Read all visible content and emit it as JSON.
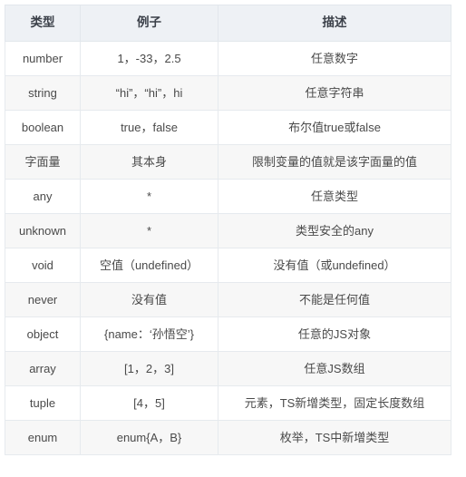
{
  "table": {
    "columns": [
      {
        "key": "type",
        "label": "类型"
      },
      {
        "key": "example",
        "label": "例子"
      },
      {
        "key": "description",
        "label": "描述"
      }
    ],
    "rows": [
      {
        "type": "number",
        "example": "1，-33，2.5",
        "description": "任意数字"
      },
      {
        "type": "string",
        "example": "“hi”，“hi”，hi",
        "description": "任意字符串"
      },
      {
        "type": "boolean",
        "example": "true，false",
        "description": "布尔值true或false"
      },
      {
        "type": "字面量",
        "example": "其本身",
        "description": "限制变量的值就是该字面量的值"
      },
      {
        "type": "any",
        "example": "*",
        "description": "任意类型"
      },
      {
        "type": "unknown",
        "example": "*",
        "description": "类型安全的any"
      },
      {
        "type": "void",
        "example": "空值（undefined）",
        "description": "没有值（或undefined）"
      },
      {
        "type": "never",
        "example": "没有值",
        "description": "不能是任何值"
      },
      {
        "type": "object",
        "example": "{name：‘孙悟空’}",
        "description": "任意的JS对象"
      },
      {
        "type": "array",
        "example": "[1，2，3]",
        "description": "任意JS数组"
      },
      {
        "type": "tuple",
        "example": "[4，5]",
        "description": "元素，TS新增类型，固定长度数组"
      },
      {
        "type": "enum",
        "example": "enum{A，B}",
        "description": "枚举，TS中新增类型"
      }
    ]
  },
  "colors": {
    "header_background": "#eef1f5",
    "header_text": "#3b4049",
    "body_text": "#4a4a4a",
    "row_stripe": "#f7f7f7",
    "row_base": "#ffffff",
    "border": "#e6eaee"
  }
}
